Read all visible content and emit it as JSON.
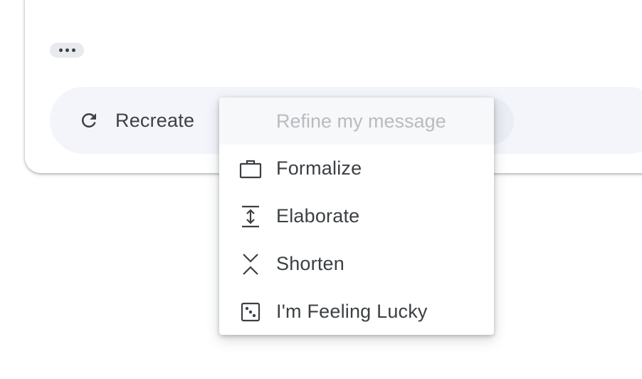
{
  "compose_card": {
    "more_options_icon": "more-horizontal-icon"
  },
  "action_bar": {
    "recreate_label": "Recreate",
    "recreate_icon": "refresh-icon"
  },
  "refine_menu": {
    "header": "Refine my message",
    "items": [
      {
        "label": "Formalize",
        "icon": "briefcase-icon"
      },
      {
        "label": "Elaborate",
        "icon": "expand-vertical-icon"
      },
      {
        "label": "Shorten",
        "icon": "collapse-vertical-icon"
      },
      {
        "label": "I'm Feeling Lucky",
        "icon": "dice-icon"
      }
    ]
  },
  "colors": {
    "text": "#3c4043",
    "muted_text": "#b8bbbf",
    "action_bar_bg": "#f3f5fb",
    "chip_bg": "#e8eaed"
  }
}
